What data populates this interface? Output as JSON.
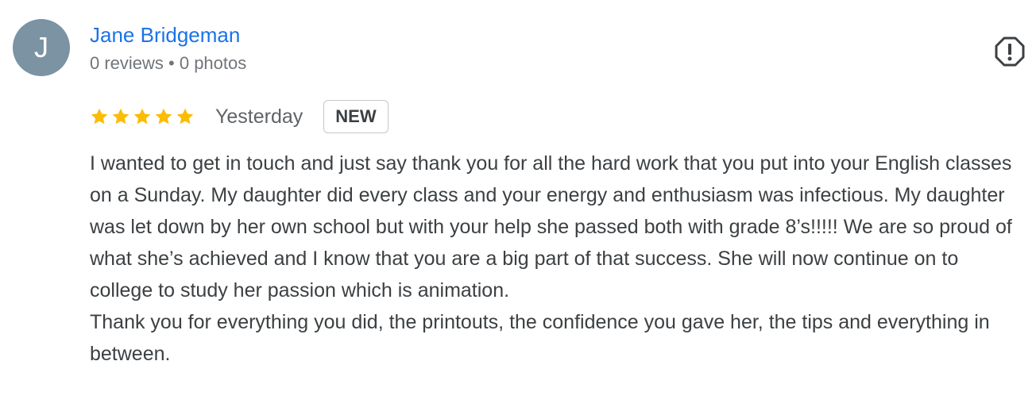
{
  "reviewer": {
    "avatar_initial": "J",
    "name": "Jane Bridgeman",
    "meta": "0 reviews • 0 photos"
  },
  "review": {
    "rating": 5,
    "rating_max": 5,
    "date": "Yesterday",
    "badge": "NEW",
    "text": "I wanted to get in touch and just say thank you for all the hard work that you put into your English classes on a Sunday. My daughter did every class and your energy and enthusiasm was infectious. My daughter was let down by her own school but with your help she passed both with grade 8’s!!!!! We are so proud of what she’s achieved and I know that you are a big part of that success. She will now continue on to college to study her passion which is animation.\nThank you for everything you did, the printouts, the confidence you gave her, the tips and everything in between."
  },
  "icons": {
    "report": "flag-report-icon",
    "star": "star-icon"
  },
  "colors": {
    "name_link": "#1a73e8",
    "avatar_bg": "#7b93a3",
    "star": "#fbbc04",
    "secondary_text": "#70757a",
    "body_text": "#3c4043"
  }
}
